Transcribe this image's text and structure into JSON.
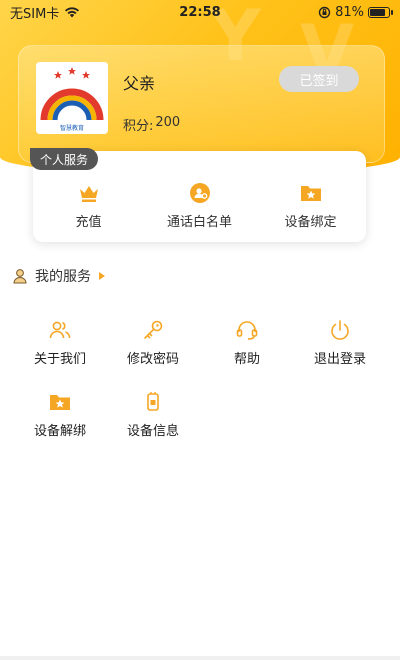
{
  "status_bar": {
    "carrier": "无SIM卡",
    "time": "22:58",
    "battery_percent": "81%",
    "battery_level": 0.81
  },
  "profile": {
    "name": "父亲",
    "points_label": "积分:",
    "points_value": "200",
    "signin_label": "已签到",
    "avatar_caption": "智慧教育"
  },
  "personal_services": {
    "tag": "个人服务",
    "items": [
      {
        "label": "充值",
        "icon": "crown-icon"
      },
      {
        "label": "通话白名单",
        "icon": "contact-icon"
      },
      {
        "label": "设备绑定",
        "icon": "folder-star-icon"
      }
    ]
  },
  "my_services": {
    "title": "我的服务",
    "items": [
      {
        "label": "关于我们",
        "icon": "users-icon"
      },
      {
        "label": "修改密码",
        "icon": "key-icon"
      },
      {
        "label": "帮助",
        "icon": "headset-icon"
      },
      {
        "label": "退出登录",
        "icon": "power-icon"
      },
      {
        "label": "设备解绑",
        "icon": "folder-star-icon"
      },
      {
        "label": "设备信息",
        "icon": "device-icon"
      }
    ]
  },
  "colors": {
    "accent": "#f5a623",
    "header_yellow": "#ffc21a",
    "tag_dark": "#555555",
    "signin_gray": "#d9d9d9"
  }
}
